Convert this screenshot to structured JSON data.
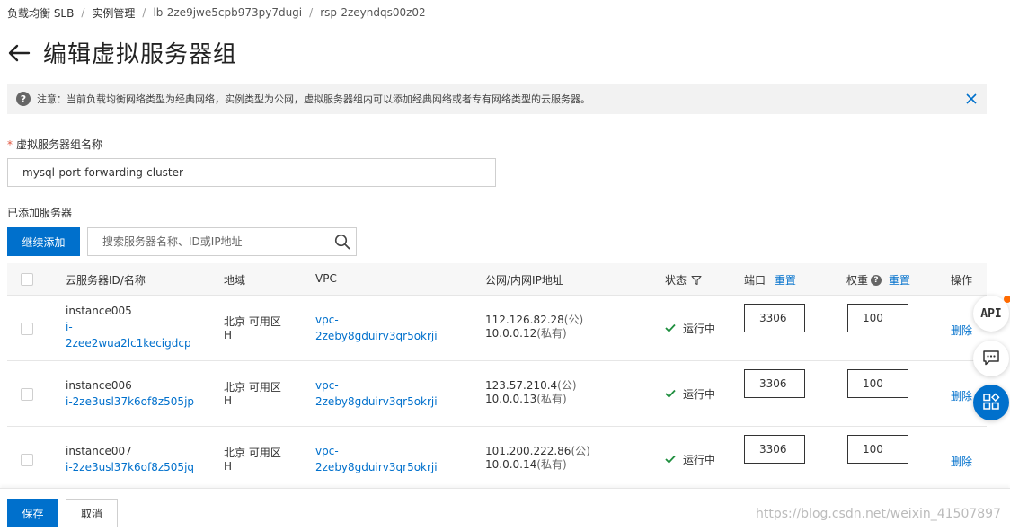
{
  "breadcrumb": [
    {
      "label": "负载均衡 SLB"
    },
    {
      "label": "实例管理"
    },
    {
      "label": "lb-2ze9jwe5cpb973py7dugi"
    },
    {
      "label": "rsp-2zeyndqs00z02"
    }
  ],
  "page": {
    "title": "编辑虚拟服务器组"
  },
  "notice": {
    "text": "注意：当前负载均衡网络类型为经典网络，实例类型为公网，虚拟服务器组内可以添加经典网络或者专有网络类型的云服务器。"
  },
  "form": {
    "name_label": "虚拟服务器组名称",
    "required_mark": "*",
    "name_value": "mysql-port-forwarding-cluster"
  },
  "servers": {
    "section_label": "已添加服务器",
    "add_button": "继续添加",
    "search_placeholder": "搜索服务器名称、ID或IP地址",
    "columns": {
      "instance": "云服务器ID/名称",
      "region": "地域",
      "vpc": "VPC",
      "ip": "公网/内网IP地址",
      "status": "状态",
      "port": "端口",
      "port_reset": "重置",
      "weight": "权重",
      "weight_reset": "重置",
      "action": "操作"
    },
    "rows": [
      {
        "name": "instance005",
        "id_lines": [
          "i-",
          "2zee2wua2lc1kecigdcp"
        ],
        "region_lines": [
          "北京 可用区",
          "H"
        ],
        "vpc_lines": [
          "vpc-",
          "2zeby8gduirv3qr5okrji"
        ],
        "public_ip": "112.126.82.28",
        "public_tag": "(公)",
        "private_ip": "10.0.0.12",
        "private_tag": "(私有)",
        "status": "运行中",
        "port": "3306",
        "weight": "100",
        "action": "删除"
      },
      {
        "name": "instance006",
        "id_lines": [
          "i-2ze3usl37k6of8z505jp"
        ],
        "region_lines": [
          "北京 可用区",
          "H"
        ],
        "vpc_lines": [
          "vpc-",
          "2zeby8gduirv3qr5okrji"
        ],
        "public_ip": "123.57.210.4",
        "public_tag": "(公)",
        "private_ip": "10.0.0.13",
        "private_tag": "(私有)",
        "status": "运行中",
        "port": "3306",
        "weight": "100",
        "action": "删除"
      },
      {
        "name": "instance007",
        "id_lines": [
          "i-2ze3usl37k6of8z505jq"
        ],
        "region_lines": [
          "北京 可用区",
          "H"
        ],
        "vpc_lines": [
          "vpc-",
          "2zeby8gduirv3qr5okrji"
        ],
        "public_ip": "101.200.222.86",
        "public_tag": "(公)",
        "private_ip": "10.0.0.14",
        "private_tag": "(私有)",
        "status": "运行中",
        "port": "3306",
        "weight": "100",
        "action": "删除"
      }
    ]
  },
  "footer": {
    "save": "保存",
    "cancel": "取消"
  },
  "floating": {
    "api_label": "API"
  },
  "watermark": "https://blog.csdn.net/weixin_41507897",
  "colors": {
    "primary": "#0070cc",
    "success": "#1e8e3e",
    "notice_bg": "#f2f2f2",
    "badge": "#ff6a00"
  }
}
